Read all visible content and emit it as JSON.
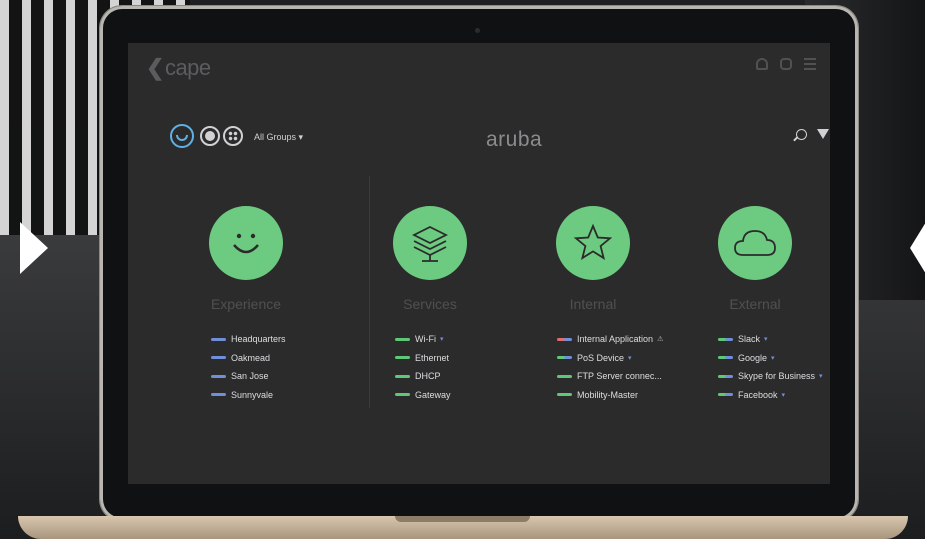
{
  "app": {
    "logo": "cape",
    "logo_chevron": "❮",
    "brand": "aruba"
  },
  "toolbar": {
    "group_selector": "All Groups ▾",
    "views": [
      "experience-view",
      "globe-view",
      "grid-view"
    ]
  },
  "columns": [
    {
      "title": "Experience",
      "icon": "smiley-icon",
      "items": [
        {
          "label": "Headquarters",
          "bar": "blue"
        },
        {
          "label": "Oakmead",
          "bar": "blue"
        },
        {
          "label": "San Jose",
          "bar": "blue"
        },
        {
          "label": "Sunnyvale",
          "bar": "blue"
        }
      ]
    },
    {
      "title": "Services",
      "icon": "layers-icon",
      "items": [
        {
          "label": "Wi-Fi",
          "bar": "green",
          "badge": "▾"
        },
        {
          "label": "Ethernet",
          "bar": "green"
        },
        {
          "label": "DHCP",
          "bar": "green"
        },
        {
          "label": "Gateway",
          "bar": "green"
        }
      ]
    },
    {
      "title": "Internal",
      "icon": "star-icon",
      "items": [
        {
          "label": "Internal Application",
          "bar": "pink",
          "badge": "⚠"
        },
        {
          "label": "PoS Device",
          "bar": "teal",
          "badge": "▾"
        },
        {
          "label": "FTP Server connec...",
          "bar": "green"
        },
        {
          "label": "Mobility-Master",
          "bar": "green"
        }
      ]
    },
    {
      "title": "External",
      "icon": "cloud-icon",
      "items": [
        {
          "label": "Slack",
          "bar": "teal",
          "badge": "▾"
        },
        {
          "label": "Google",
          "bar": "teal",
          "badge": "▾"
        },
        {
          "label": "Skype for Business",
          "bar": "teal",
          "badge": "▾"
        },
        {
          "label": "Facebook",
          "bar": "teal",
          "badge": "▾"
        }
      ]
    }
  ],
  "colors": {
    "accent_green": "#6ccb80",
    "accent_blue": "#5fb2e6",
    "screen_bg": "#2b2b2c"
  }
}
